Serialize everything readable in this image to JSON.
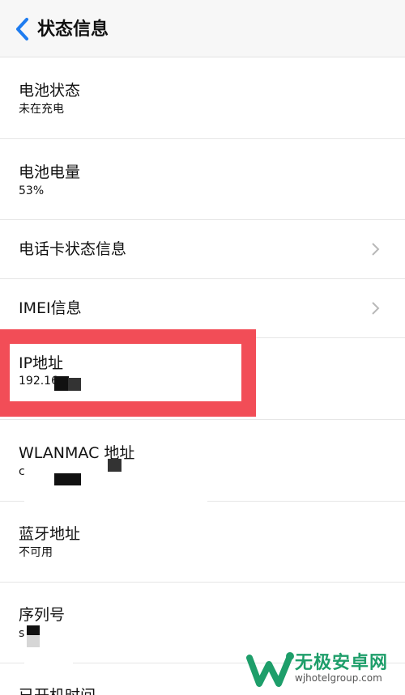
{
  "header": {
    "title": "状态信息"
  },
  "rows": [
    {
      "title": "电池状态",
      "subtitle": "未在充电"
    },
    {
      "title": "电池电量",
      "subtitle": "53%"
    },
    {
      "title": "电话卡状态信息"
    },
    {
      "title": "IMEI信息"
    },
    {
      "title": "IP地址",
      "subtitle": "192.16"
    },
    {
      "title": "WLANMAC 地址",
      "subtitle": "c"
    },
    {
      "title": "蓝牙地址",
      "subtitle": "不可用"
    },
    {
      "title": "序列号",
      "subtitle": "s"
    },
    {
      "title": "已开机时间"
    }
  ],
  "colors": {
    "accent": "#1e7cf0",
    "highlight": "#f24d57",
    "watermark_green": "#1e9e6a"
  },
  "watermark": {
    "title": "无极安卓网",
    "url": "wjhotelgroup.com"
  }
}
